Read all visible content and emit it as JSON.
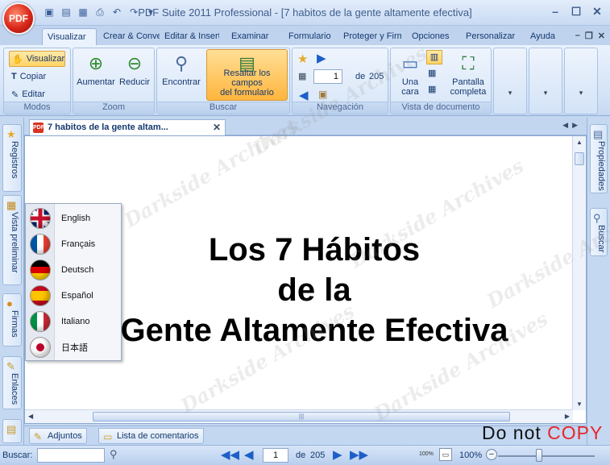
{
  "app": {
    "title": "PDF Suite 2011 Professional - [7 habitos de la gente altamente efectiva]",
    "orb_label": "PDF"
  },
  "window_controls": {
    "minimize": "–",
    "maximize": "☐",
    "close": "✕"
  },
  "ribbon_tabs": [
    {
      "label": "Visualizar",
      "active": true
    },
    {
      "label": "Crear & Convertir"
    },
    {
      "label": "Editar & Insertar"
    },
    {
      "label": "Examinar"
    },
    {
      "label": "Formulario"
    },
    {
      "label": "Proteger y Firmar"
    },
    {
      "label": "Opciones"
    },
    {
      "label": "Personalizar"
    },
    {
      "label": "Ayuda"
    }
  ],
  "ribbon": {
    "modos": {
      "label": "Modos",
      "visualizar": "Visualizar",
      "copiar": "Copiar",
      "editar": "Editar"
    },
    "zoom": {
      "label": "Zoom",
      "aumentar": "Aumentar",
      "reducir": "Reducir"
    },
    "buscar": {
      "label": "Buscar",
      "encontrar": "Encontrar",
      "resaltar_line1": "Resaltar los campos",
      "resaltar_line2": "del formulario"
    },
    "navegacion": {
      "label": "Navegación",
      "page": "1",
      "of": "de",
      "total": "205"
    },
    "vista": {
      "label": "Vista de documento",
      "una_cara_line1": "Una",
      "una_cara_line2": "cara",
      "pantalla_line1": "Pantalla",
      "pantalla_line2": "completa"
    }
  },
  "document_tab": {
    "title": "7 habitos de la gente altam..."
  },
  "left_panels": [
    {
      "label": "Registros",
      "icon": "star-icon"
    },
    {
      "label": "Vista preliminar",
      "icon": "thumbnails-icon"
    },
    {
      "label": "Firmas",
      "icon": "signature-icon"
    },
    {
      "label": "Enlaces",
      "icon": "link-icon"
    }
  ],
  "right_panels": [
    {
      "label": "Propiedades",
      "icon": "properties-icon"
    },
    {
      "label": "Buscar",
      "icon": "search-icon"
    }
  ],
  "document": {
    "line1": "Los 7 Hábitos",
    "line2": "de la",
    "line3": "Gente Altamente Efectiva"
  },
  "language_menu": [
    {
      "label": "English",
      "flag": "uk-flag-icon"
    },
    {
      "label": "Français",
      "flag": "france-flag-icon"
    },
    {
      "label": "Deutsch",
      "flag": "germany-flag-icon"
    },
    {
      "label": "Español",
      "flag": "spain-flag-icon"
    },
    {
      "label": "Italiano",
      "flag": "italy-flag-icon"
    },
    {
      "label": "日本語",
      "flag": "japan-flag-icon"
    }
  ],
  "bottom_tabs": {
    "adjuntos": "Adjuntos",
    "comentarios": "Lista de comentarios"
  },
  "statusbar": {
    "search_label": "Buscar:",
    "search_value": "",
    "page": "1",
    "of": "de",
    "total": "205",
    "zoom_small": "100%",
    "zoom_value": "100%",
    "zoom_level_percent": 100
  },
  "watermark": {
    "text": "Darkside Archives",
    "donotcopy_plain": "Do not ",
    "donotcopy_accent": "COPY"
  },
  "colors": {
    "accent": "#ffb53e",
    "ribbon_bg": "#d4e3f7",
    "nav_arrow": "#1d5fc7",
    "brand_red": "#d9261a"
  }
}
